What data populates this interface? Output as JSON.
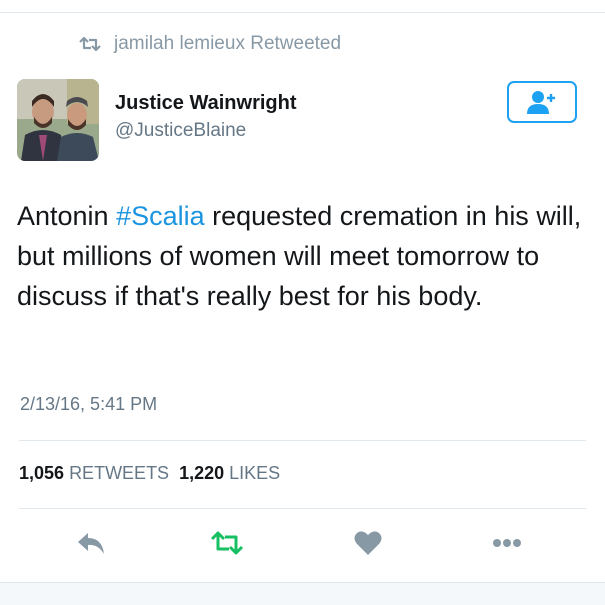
{
  "retweet_context": {
    "text": "jamilah lemieux Retweeted"
  },
  "author": {
    "display_name": "Justice Wainwright",
    "handle": "@JusticeBlaine"
  },
  "tweet": {
    "text_before": "Antonin ",
    "hashtag": "#Scalia",
    "text_after": " requested cremation in his will, but millions of women will meet tomorrow to discuss if that's really best for his body.",
    "timestamp": "2/13/16, 5:41 PM"
  },
  "stats": {
    "retweets_count": "1,056",
    "retweets_label": "RETWEETS",
    "likes_count": "1,220",
    "likes_label": "LIKES"
  },
  "icons": {
    "retweet_context": "retweet-icon",
    "follow": "add-user-icon",
    "reply": "reply-icon",
    "retweet_action": "retweet-icon",
    "like": "heart-icon",
    "more": "more-icon"
  },
  "colors": {
    "accent": "#1da1f2",
    "retweet_green": "#17bf63",
    "secondary_text": "#657786",
    "icon_gray": "#8899a6"
  }
}
